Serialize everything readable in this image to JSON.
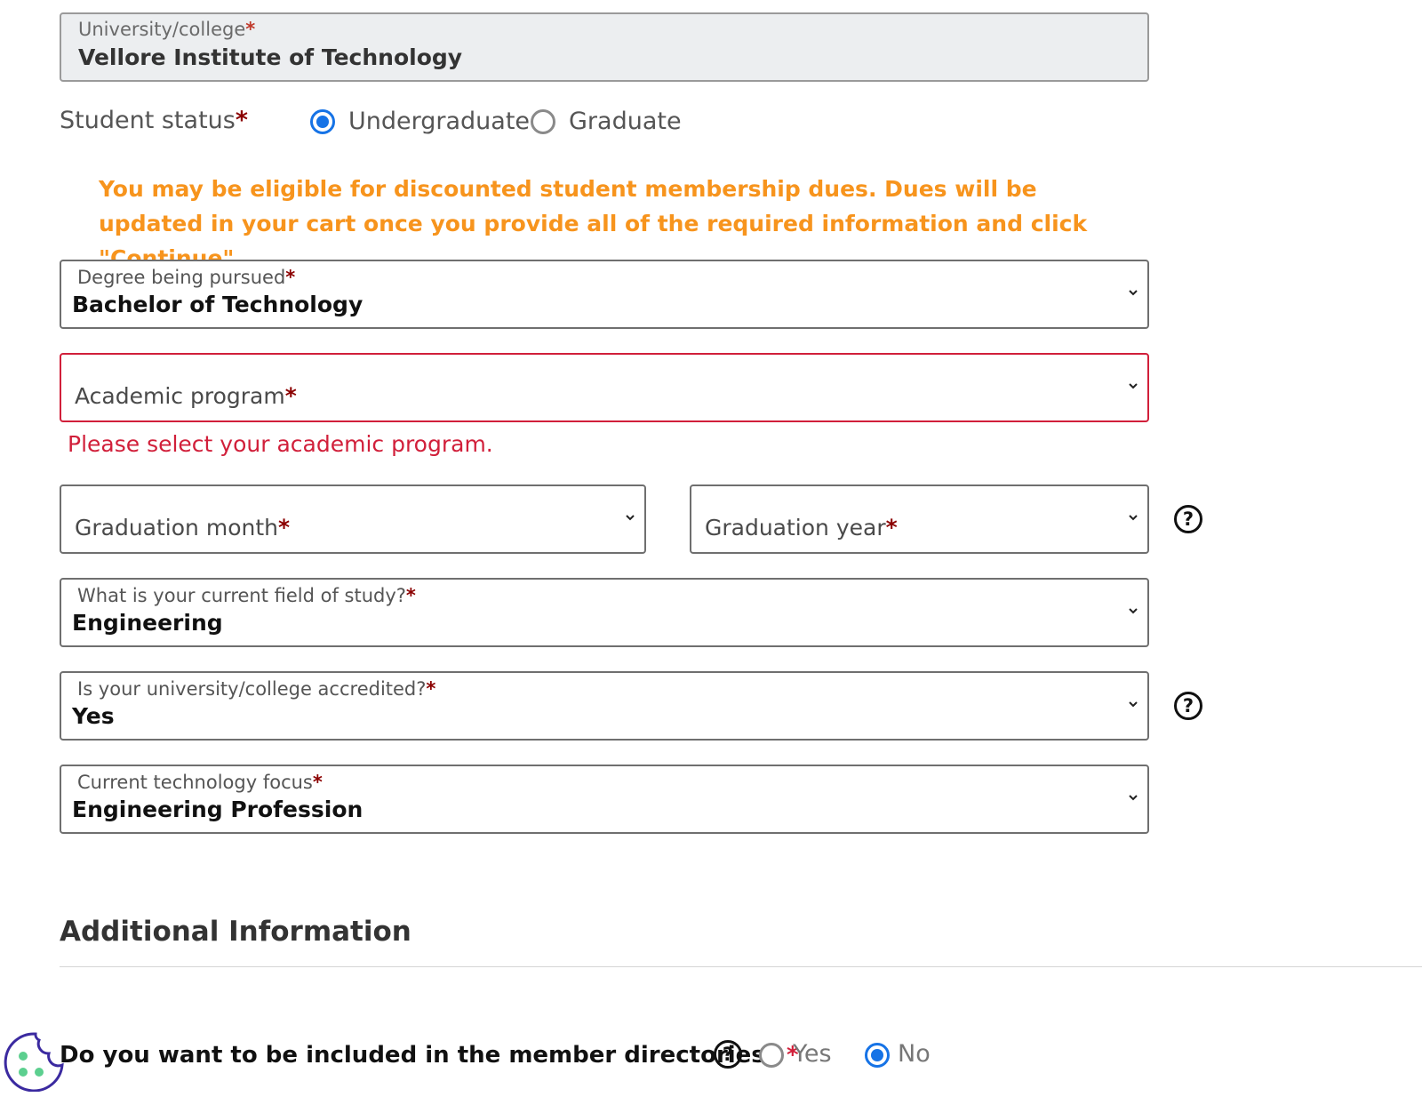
{
  "university": {
    "label": "University/college",
    "value": "Vellore Institute of Technology"
  },
  "student_status": {
    "label": "Student status",
    "options": [
      "Undergraduate",
      "Graduate"
    ],
    "selected": "Undergraduate"
  },
  "notice": "You may be eligible for discounted student membership dues. Dues will be updated in your cart once you provide all of the required information and click \"Continue\".",
  "degree": {
    "label": "Degree being pursued",
    "value": "Bachelor of Technology"
  },
  "academic_program": {
    "placeholder": "Academic program",
    "error": "Please select your academic program."
  },
  "grad_month": {
    "placeholder": "Graduation month"
  },
  "grad_year": {
    "placeholder": "Graduation year"
  },
  "field_of_study": {
    "label": "What is your current field of study?",
    "value": "Engineering"
  },
  "accredited": {
    "label": "Is your university/college accredited?",
    "value": "Yes"
  },
  "tech_focus": {
    "label": "Current technology focus",
    "value": "Engineering Profession"
  },
  "section_heading": "Additional Information",
  "directories": {
    "question": "Do you want to be included in the member directories?",
    "options": [
      "Yes",
      "No"
    ],
    "selected": "No"
  },
  "required_mark": "*",
  "help_glyph": "?",
  "colors": {
    "accent_blue": "#1673e6",
    "error_red": "#d11f3a",
    "notice_orange": "#f7941d",
    "required_mark": "#8b0000"
  },
  "icons": {
    "help": "question-circle-icon",
    "dropdown": "chevron-down-icon",
    "cookie": "cookie-settings-icon"
  }
}
